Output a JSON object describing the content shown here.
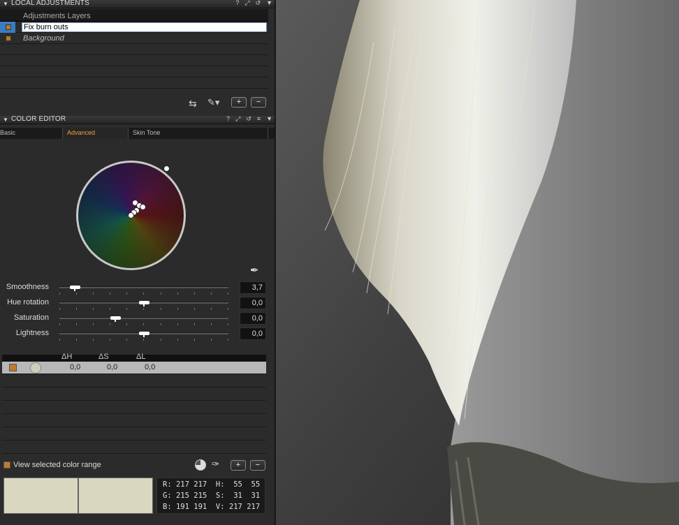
{
  "local_adjustments": {
    "title": "LOCAL ADJUSTMENTS",
    "tool_icons": [
      "help-icon",
      "pin-icon",
      "reset-icon",
      "menu-icon"
    ],
    "column_header": "Adjustments Layers",
    "layers": [
      {
        "name": "Fix burn outs",
        "selected": true
      },
      {
        "name": "Background",
        "selected": false
      }
    ],
    "add_label": "+",
    "remove_label": "−"
  },
  "color_editor": {
    "title": "COLOR EDITOR",
    "tabs": [
      "Basic",
      "Advanced",
      "Skin Tone"
    ],
    "active_tab": "Advanced",
    "sliders": [
      {
        "label": "Smoothness",
        "value": "3,7",
        "level": 0.09
      },
      {
        "label": "Hue rotation",
        "value": "0,0",
        "level": 0.5
      },
      {
        "label": "Saturation",
        "value": "0,0",
        "level": 0.33
      },
      {
        "label": "Lightness",
        "value": "0,0",
        "level": 0.5
      }
    ],
    "delta_headers": [
      "ΔH",
      "ΔS",
      "ΔL"
    ],
    "delta_row": {
      "dh": "0,0",
      "ds": "0,0",
      "dl": "0,0"
    },
    "view_range_label": "View selected color range",
    "add_label": "+",
    "remove_label": "−",
    "swatch_color": "#d9d7bf",
    "readout": {
      "r_label": "R:",
      "r1": "217",
      "r2": "217",
      "h_label": "H:",
      "h1": "55",
      "h2": "55",
      "g_label": "G:",
      "g1": "215",
      "g2": "215",
      "s_label": "S:",
      "s1": "31",
      "s2": "31",
      "b_label": "B:",
      "b1": "191",
      "b2": "191",
      "v_label": "V:",
      "v1": "217",
      "v2": "217"
    }
  },
  "colors": {
    "accent": "#e8a040",
    "selection": "#3a7cc4"
  }
}
